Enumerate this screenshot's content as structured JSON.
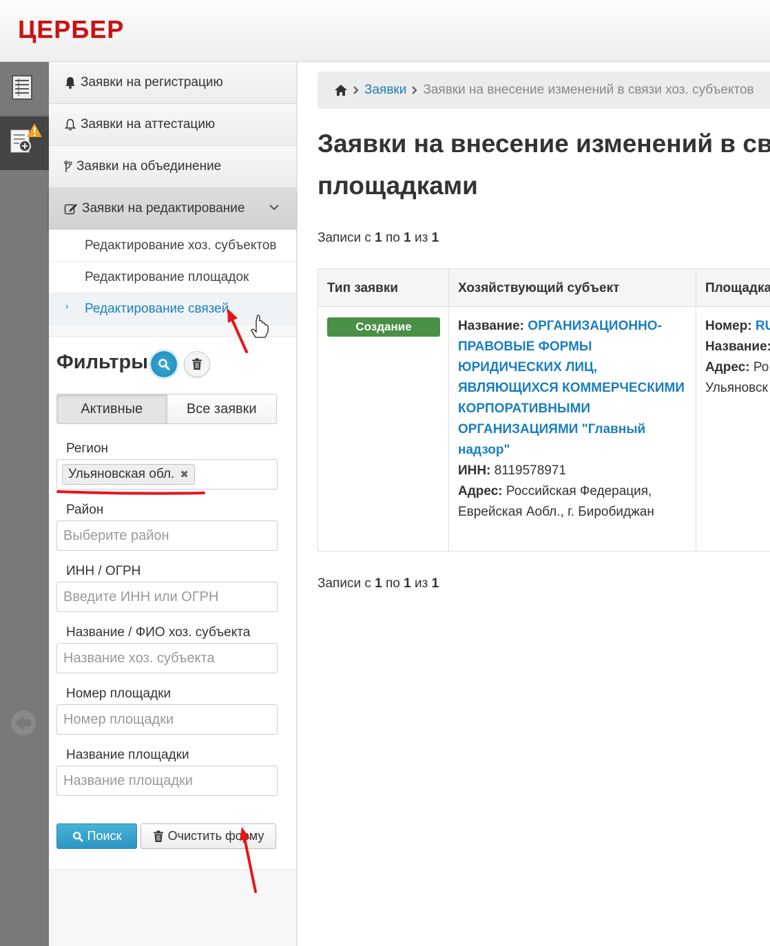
{
  "app": {
    "logo": "ЦЕРБЕР"
  },
  "nav": {
    "items": [
      {
        "label": "Заявки на регистрацию",
        "icon": "bell-icon"
      },
      {
        "label": "Заявки на аттестацию",
        "icon": "bell-outline-icon"
      },
      {
        "label": "Заявки на объединение",
        "icon": "branch-icon"
      },
      {
        "label": "Заявки на редактирование",
        "icon": "edit-icon"
      }
    ],
    "sub_items": [
      {
        "label": "Редактирование хоз. субъектов"
      },
      {
        "label": "Редактирование площадок"
      },
      {
        "label": "Редактирование связей"
      }
    ]
  },
  "filters": {
    "title": "Фильтры",
    "segments": {
      "active": "Активные",
      "all": "Все заявки"
    },
    "region": {
      "label": "Регион",
      "tag": "Ульяновская обл."
    },
    "district": {
      "label": "Район",
      "placeholder": "Выберите район"
    },
    "inn": {
      "label": "ИНН / ОГРН",
      "placeholder": "Введите ИНН или ОГРН"
    },
    "entity_name": {
      "label": "Название / ФИО хоз. субъекта",
      "placeholder": "Название хоз. субъекта"
    },
    "site_number": {
      "label": "Номер площадки",
      "placeholder": "Номер площадки"
    },
    "site_name": {
      "label": "Название площадки",
      "placeholder": "Название площадки"
    },
    "search_button": "Поиск",
    "clear_button": "Очистить форму"
  },
  "breadcrumb": {
    "link": "Заявки",
    "current": "Заявки на внесение изменений в связи хоз. субъектов"
  },
  "page": {
    "title_line1": "Заявки на внесение изменений в связи хоз. субъектов",
    "title_line2": "площадками"
  },
  "records": {
    "prefix": "Записи с",
    "from": "1",
    "mid": "по",
    "to": "1",
    "of": "из",
    "total": "1"
  },
  "table": {
    "headers": [
      "Тип заявки",
      "Хозяйствующий субъект",
      "Площадка"
    ],
    "row": {
      "type_badge": "Создание",
      "entity_name_label": "Название:",
      "entity_name": "ОРГАНИЗАЦИОННО-ПРАВОВЫЕ ФОРМЫ ЮРИДИЧЕСКИХ ЛИЦ, ЯВЛЯЮЩИХСЯ КОММЕРЧЕСКИМИ КОРПОРАТИВНЫМИ ОРГАНИЗАЦИЯМИ \"Главный надзор\"",
      "inn_label": "ИНН:",
      "inn": "8119578971",
      "address_label": "Адрес:",
      "address": "Российская Федерация, Еврейская Аобл., г. Биробиджан",
      "site_number_label": "Номер:",
      "site_number": "RU",
      "site_name_label": "Название:",
      "site_address_label": "Адрес:",
      "site_address": "Ро",
      "site_address2": "Ульяновск"
    }
  },
  "colors": {
    "brand": "#cc1111",
    "link": "#1a7fbf",
    "badge": "#4a8f46",
    "annotation": "#e8141b"
  }
}
